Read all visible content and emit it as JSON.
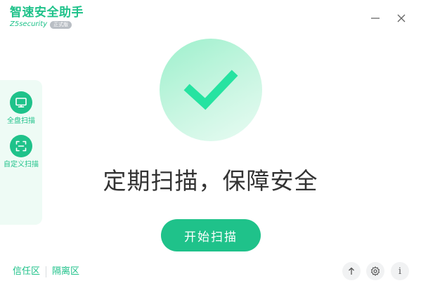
{
  "brand": {
    "title": "智速安全助手",
    "subtitle": "Z5security",
    "badge": "正式版"
  },
  "window": {
    "minimize_icon": "minus-icon",
    "close_icon": "close-icon"
  },
  "sidebar": {
    "items": [
      {
        "label": "全盘扫描",
        "icon": "monitor-icon"
      },
      {
        "label": "自定义扫描",
        "icon": "scan-frame-icon"
      }
    ]
  },
  "main": {
    "status_icon": "checkmark-icon",
    "headline": "定期扫描，保障安全",
    "start_button": "开始扫描"
  },
  "footer": {
    "links": [
      "信任区",
      "隔离区"
    ],
    "buttons": [
      {
        "icon": "upload-arrow-icon"
      },
      {
        "icon": "gear-icon"
      },
      {
        "icon": "info-icon",
        "glyph": "i"
      }
    ]
  },
  "colors": {
    "accent": "#1fc28a",
    "sidebar_bg": "#eefbf5",
    "headline": "#333333",
    "hero_light": "#c9f6e2"
  }
}
